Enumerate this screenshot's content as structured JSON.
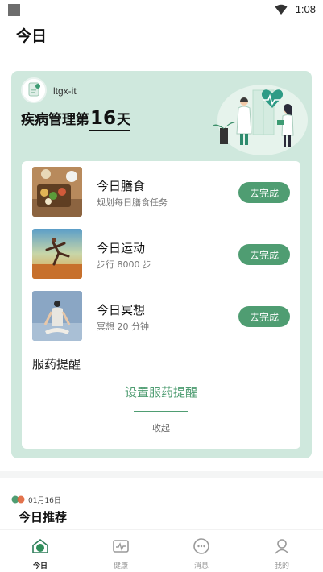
{
  "status_bar": {
    "time": "1:08",
    "wifi_icon": "wifi-icon"
  },
  "header": {
    "title": "今日"
  },
  "card": {
    "username": "ltgx-it",
    "headline_prefix": "疾病管理第",
    "day_count": "16",
    "headline_suffix": "天",
    "tasks": [
      {
        "title": "今日膳食",
        "desc": "规划每日膳食任务",
        "button": "去完成"
      },
      {
        "title": "今日运动",
        "desc": "步行 8000 步",
        "button": "去完成"
      },
      {
        "title": "今日冥想",
        "desc": "冥想 20 分钟",
        "button": "去完成"
      }
    ],
    "medication": {
      "title": "服药提醒",
      "link": "设置服药提醒",
      "collapse": "收起"
    }
  },
  "recommend": {
    "date": "01月16日",
    "title": "今日推荐"
  },
  "tabs": [
    {
      "label": "今日",
      "icon": "home-icon",
      "active": true
    },
    {
      "label": "健康",
      "icon": "health-icon",
      "active": false
    },
    {
      "label": "消息",
      "icon": "message-icon",
      "active": false
    },
    {
      "label": "我的",
      "icon": "profile-icon",
      "active": false
    }
  ],
  "colors": {
    "accent": "#4f9d72",
    "card_bg": "#cfe8dd",
    "active_icon": "#2f8f5b"
  }
}
